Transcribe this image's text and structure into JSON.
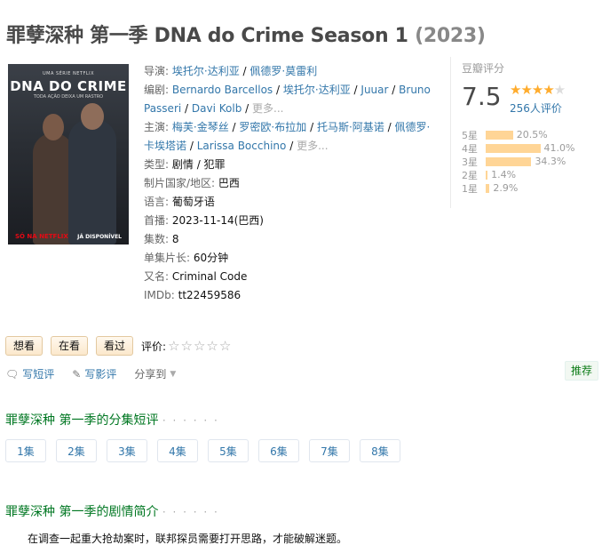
{
  "title": {
    "main": "罪孽深种 第一季 DNA do Crime Season 1",
    "year": "(2023)"
  },
  "poster": {
    "top_text": "UMA SÉRIE NETFLIX",
    "title": "DNA DO CRIME",
    "tagline": "TODA AÇÃO DEIXA UM RASTRO",
    "brand": "SÓ NA NETFLIX",
    "availability": "JÁ DISPONÍVEL"
  },
  "info": {
    "director_label": "导演:",
    "directors": [
      "埃托尔·达利亚",
      "佩德罗·莫雷利"
    ],
    "writer_label": "编剧:",
    "writers": [
      "Bernardo Barcellos",
      "埃托尔·达利亚",
      "Juuar",
      "Bruno Passeri",
      "Davi Kolb"
    ],
    "writers_more": "更多...",
    "cast_label": "主演:",
    "cast": [
      "梅芙·金琴丝",
      "罗密欧·布拉加",
      "托马斯·阿基诺",
      "佩德罗·卡埃塔诺",
      "Larissa Bocchino"
    ],
    "cast_more": "更多...",
    "genre_label": "类型:",
    "genre": "剧情 / 犯罪",
    "country_label": "制片国家/地区:",
    "country": "巴西",
    "language_label": "语言:",
    "language": "葡萄牙语",
    "premiere_label": "首播:",
    "premiere": "2023-11-14(巴西)",
    "episodes_label": "集数:",
    "episodes": "8",
    "runtime_label": "单集片长:",
    "runtime": "60分钟",
    "aka_label": "又名:",
    "aka": "Criminal Code",
    "imdb_label": "IMDb:",
    "imdb": "tt22459586"
  },
  "rating": {
    "label": "豆瓣评分",
    "score": "7.5",
    "stars_value": 4,
    "count": "256人评价",
    "distribution": [
      {
        "label": "5星",
        "pct": "20.5%",
        "value": 20.5
      },
      {
        "label": "4星",
        "pct": "41.0%",
        "value": 41.0
      },
      {
        "label": "3星",
        "pct": "34.3%",
        "value": 34.3
      },
      {
        "label": "2星",
        "pct": "1.4%",
        "value": 1.4
      },
      {
        "label": "1星",
        "pct": "2.9%",
        "value": 2.9
      }
    ]
  },
  "actions": {
    "want": "想看",
    "doing": "在看",
    "done": "看过",
    "rate_label": "评价:",
    "rate_stars": "☆☆☆☆☆"
  },
  "share": {
    "short_review": "写短评",
    "review": "写影评",
    "share_to": "分享到"
  },
  "recommend": "推荐",
  "episode_section": {
    "title": "罪孽深种 第一季的分集短评",
    "dots": "· · · · · ·",
    "episodes": [
      "1集",
      "2集",
      "3集",
      "4集",
      "5集",
      "6集",
      "7集",
      "8集"
    ]
  },
  "synopsis_section": {
    "title": "罪孽深种 第一季的剧情简介",
    "dots": "· · · · · ·",
    "text": "在调查一起重大抢劫案时，联邦探员需要打开思路，才能破解迷题。"
  },
  "colors": {
    "link": "#3377aa",
    "green": "#007722",
    "star": "#ffac2d",
    "bar": "#ffd596"
  }
}
